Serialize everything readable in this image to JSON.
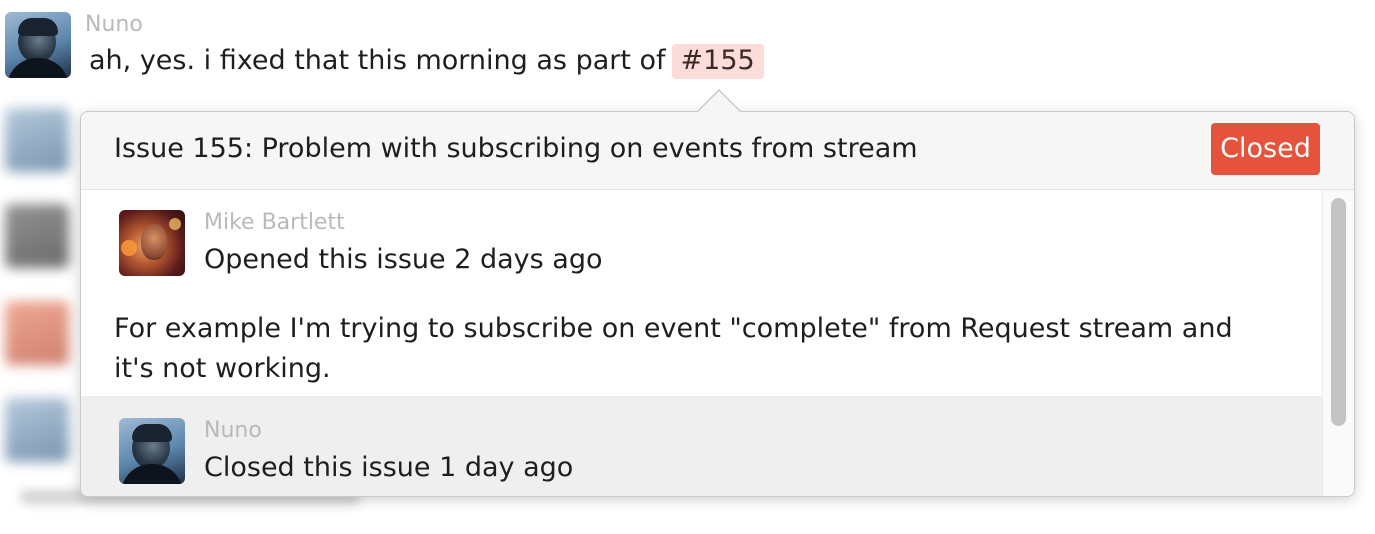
{
  "chat": {
    "message": {
      "author": "Nuno",
      "text": "ah, yes. i fixed that this morning as part of",
      "issue_ref": "#155"
    }
  },
  "popover": {
    "title": "Issue 155: Problem with subscribing on events from stream",
    "status": "Closed",
    "colors": {
      "status": "#e5533c",
      "issue_ref_bg": "#fbdcd8",
      "header_bg": "#f6f6f6"
    },
    "events": [
      {
        "author": "Mike Bartlett",
        "action": "Opened this issue 2 days ago"
      },
      {
        "author": "Nuno",
        "action": "Closed this issue 1 day ago"
      }
    ],
    "comment": "For example I'm trying to subscribe on event \"complete\" from Request stream and it's not working."
  }
}
